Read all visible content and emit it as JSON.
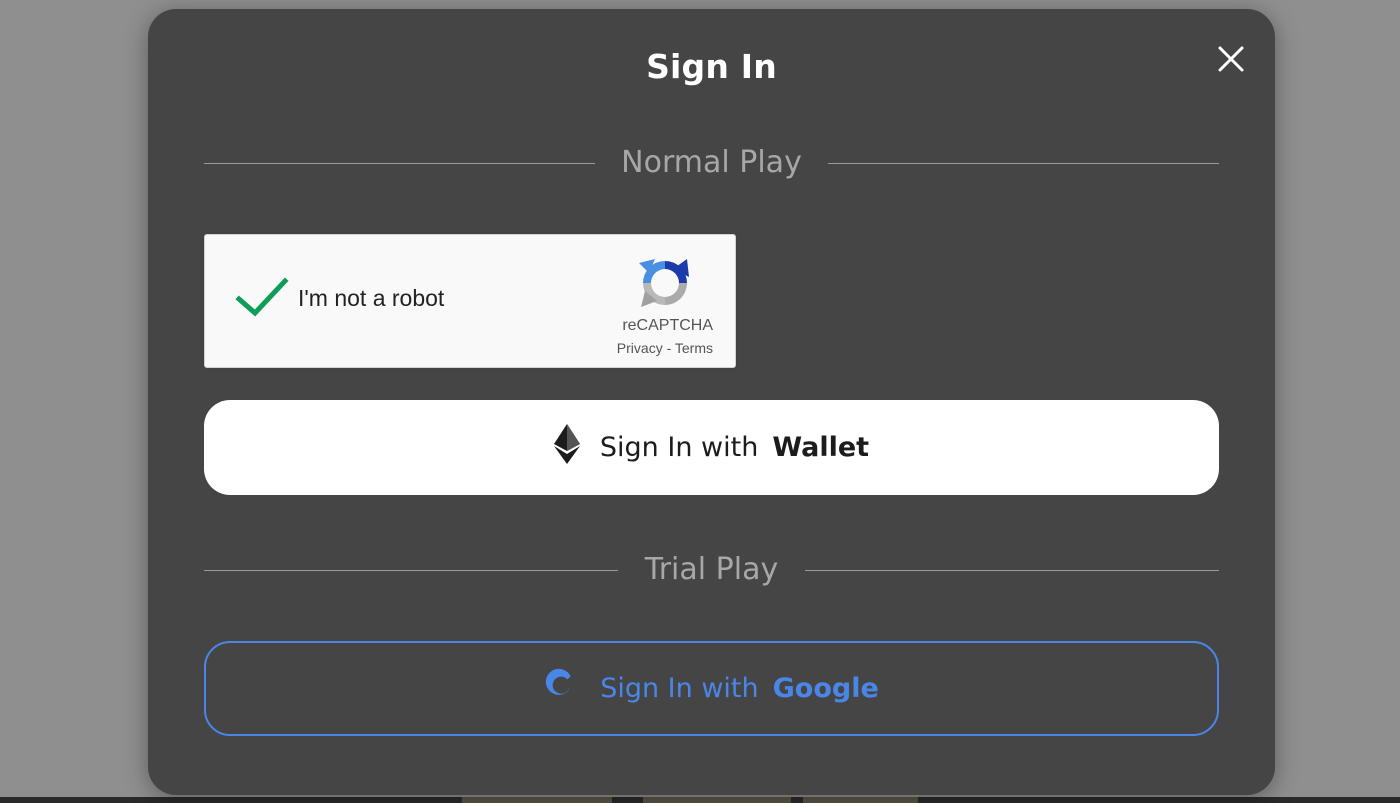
{
  "modal": {
    "title": "Sign In",
    "close_icon": "close-icon"
  },
  "sections": {
    "normal_play": "Normal Play",
    "trial_play": "Trial Play"
  },
  "recaptcha": {
    "label": "I'm not a robot",
    "checked": true,
    "brand": "reCAPTCHA",
    "links": "Privacy - Terms",
    "check_color": "#0f9d58"
  },
  "wallet_button": {
    "prefix": "Sign In with",
    "provider": "Wallet",
    "icon": "ethereum-icon"
  },
  "google_button": {
    "prefix": "Sign In with",
    "provider": "Google",
    "icon": "google-icon",
    "accent": "#4a86e8"
  }
}
